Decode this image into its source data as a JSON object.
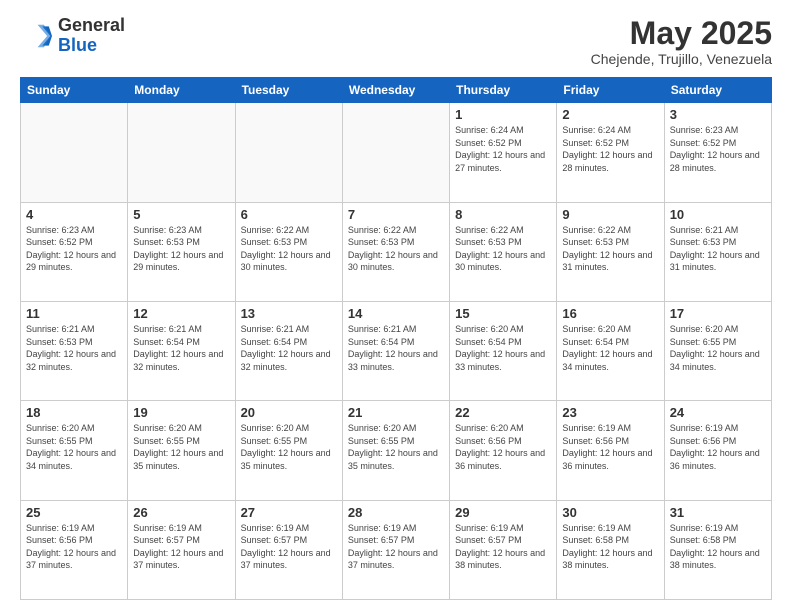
{
  "header": {
    "logo_general": "General",
    "logo_blue": "Blue",
    "month_title": "May 2025",
    "subtitle": "Chejende, Trujillo, Venezuela"
  },
  "weekdays": [
    "Sunday",
    "Monday",
    "Tuesday",
    "Wednesday",
    "Thursday",
    "Friday",
    "Saturday"
  ],
  "weeks": [
    [
      {
        "day": "",
        "info": ""
      },
      {
        "day": "",
        "info": ""
      },
      {
        "day": "",
        "info": ""
      },
      {
        "day": "",
        "info": ""
      },
      {
        "day": "1",
        "info": "Sunrise: 6:24 AM\nSunset: 6:52 PM\nDaylight: 12 hours and 27 minutes."
      },
      {
        "day": "2",
        "info": "Sunrise: 6:24 AM\nSunset: 6:52 PM\nDaylight: 12 hours and 28 minutes."
      },
      {
        "day": "3",
        "info": "Sunrise: 6:23 AM\nSunset: 6:52 PM\nDaylight: 12 hours and 28 minutes."
      }
    ],
    [
      {
        "day": "4",
        "info": "Sunrise: 6:23 AM\nSunset: 6:52 PM\nDaylight: 12 hours and 29 minutes."
      },
      {
        "day": "5",
        "info": "Sunrise: 6:23 AM\nSunset: 6:53 PM\nDaylight: 12 hours and 29 minutes."
      },
      {
        "day": "6",
        "info": "Sunrise: 6:22 AM\nSunset: 6:53 PM\nDaylight: 12 hours and 30 minutes."
      },
      {
        "day": "7",
        "info": "Sunrise: 6:22 AM\nSunset: 6:53 PM\nDaylight: 12 hours and 30 minutes."
      },
      {
        "day": "8",
        "info": "Sunrise: 6:22 AM\nSunset: 6:53 PM\nDaylight: 12 hours and 30 minutes."
      },
      {
        "day": "9",
        "info": "Sunrise: 6:22 AM\nSunset: 6:53 PM\nDaylight: 12 hours and 31 minutes."
      },
      {
        "day": "10",
        "info": "Sunrise: 6:21 AM\nSunset: 6:53 PM\nDaylight: 12 hours and 31 minutes."
      }
    ],
    [
      {
        "day": "11",
        "info": "Sunrise: 6:21 AM\nSunset: 6:53 PM\nDaylight: 12 hours and 32 minutes."
      },
      {
        "day": "12",
        "info": "Sunrise: 6:21 AM\nSunset: 6:54 PM\nDaylight: 12 hours and 32 minutes."
      },
      {
        "day": "13",
        "info": "Sunrise: 6:21 AM\nSunset: 6:54 PM\nDaylight: 12 hours and 32 minutes."
      },
      {
        "day": "14",
        "info": "Sunrise: 6:21 AM\nSunset: 6:54 PM\nDaylight: 12 hours and 33 minutes."
      },
      {
        "day": "15",
        "info": "Sunrise: 6:20 AM\nSunset: 6:54 PM\nDaylight: 12 hours and 33 minutes."
      },
      {
        "day": "16",
        "info": "Sunrise: 6:20 AM\nSunset: 6:54 PM\nDaylight: 12 hours and 34 minutes."
      },
      {
        "day": "17",
        "info": "Sunrise: 6:20 AM\nSunset: 6:55 PM\nDaylight: 12 hours and 34 minutes."
      }
    ],
    [
      {
        "day": "18",
        "info": "Sunrise: 6:20 AM\nSunset: 6:55 PM\nDaylight: 12 hours and 34 minutes."
      },
      {
        "day": "19",
        "info": "Sunrise: 6:20 AM\nSunset: 6:55 PM\nDaylight: 12 hours and 35 minutes."
      },
      {
        "day": "20",
        "info": "Sunrise: 6:20 AM\nSunset: 6:55 PM\nDaylight: 12 hours and 35 minutes."
      },
      {
        "day": "21",
        "info": "Sunrise: 6:20 AM\nSunset: 6:55 PM\nDaylight: 12 hours and 35 minutes."
      },
      {
        "day": "22",
        "info": "Sunrise: 6:20 AM\nSunset: 6:56 PM\nDaylight: 12 hours and 36 minutes."
      },
      {
        "day": "23",
        "info": "Sunrise: 6:19 AM\nSunset: 6:56 PM\nDaylight: 12 hours and 36 minutes."
      },
      {
        "day": "24",
        "info": "Sunrise: 6:19 AM\nSunset: 6:56 PM\nDaylight: 12 hours and 36 minutes."
      }
    ],
    [
      {
        "day": "25",
        "info": "Sunrise: 6:19 AM\nSunset: 6:56 PM\nDaylight: 12 hours and 37 minutes."
      },
      {
        "day": "26",
        "info": "Sunrise: 6:19 AM\nSunset: 6:57 PM\nDaylight: 12 hours and 37 minutes."
      },
      {
        "day": "27",
        "info": "Sunrise: 6:19 AM\nSunset: 6:57 PM\nDaylight: 12 hours and 37 minutes."
      },
      {
        "day": "28",
        "info": "Sunrise: 6:19 AM\nSunset: 6:57 PM\nDaylight: 12 hours and 37 minutes."
      },
      {
        "day": "29",
        "info": "Sunrise: 6:19 AM\nSunset: 6:57 PM\nDaylight: 12 hours and 38 minutes."
      },
      {
        "day": "30",
        "info": "Sunrise: 6:19 AM\nSunset: 6:58 PM\nDaylight: 12 hours and 38 minutes."
      },
      {
        "day": "31",
        "info": "Sunrise: 6:19 AM\nSunset: 6:58 PM\nDaylight: 12 hours and 38 minutes."
      }
    ]
  ]
}
